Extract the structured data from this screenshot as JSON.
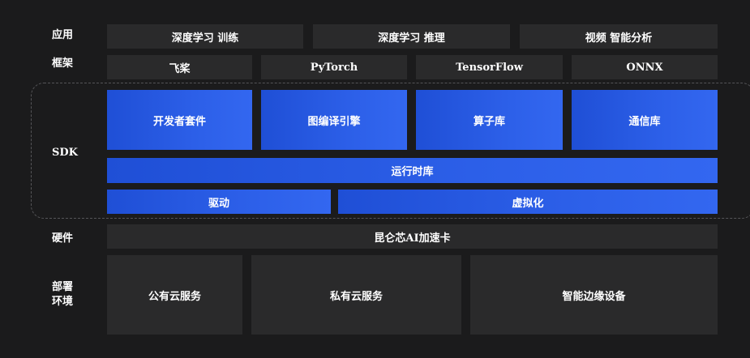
{
  "colors": {
    "background": "#1b1b1c",
    "dark_box": "#2a2a2b",
    "blue_box": "#2c5fe8",
    "dashed_border": "#555558",
    "text": "#ffffff"
  },
  "layers": {
    "application": {
      "label": "应用",
      "items": [
        "深度学习 训练",
        "深度学习 推理",
        "视频 智能分析"
      ]
    },
    "framework": {
      "label": "框架",
      "items": [
        "飞桨",
        "PyTorch",
        "TensorFlow",
        "ONNX"
      ]
    },
    "sdk": {
      "label": "SDK",
      "top_items": [
        "开发者套件",
        "图编译引擎",
        "算子库",
        "通信库"
      ],
      "runtime": "运行时库",
      "bottom_items": [
        "驱动",
        "虚拟化"
      ]
    },
    "hardware": {
      "label": "硬件",
      "item": "昆仑芯AI加速卡"
    },
    "deployment": {
      "label_line1": "部署",
      "label_line2": "环境",
      "items": [
        "公有云服务",
        "私有云服务",
        "智能边缘设备"
      ]
    }
  }
}
